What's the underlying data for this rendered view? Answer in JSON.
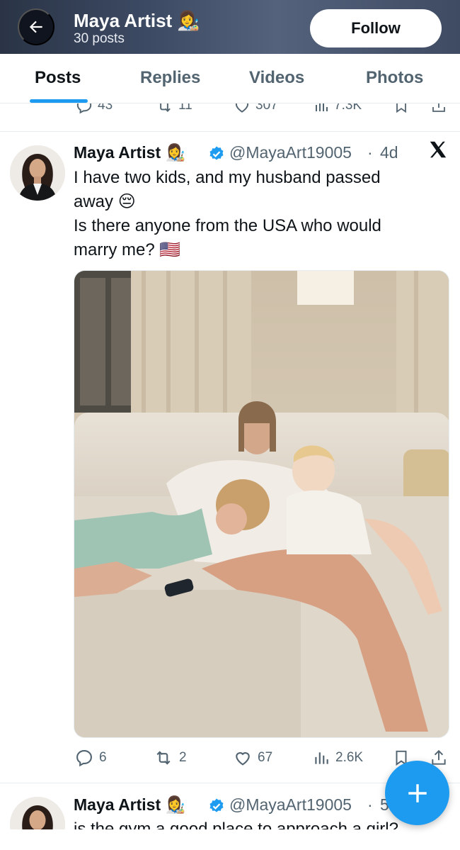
{
  "header": {
    "name": "Maya Artist 👩‍🎨",
    "posts_count": "30 posts",
    "follow_label": "Follow"
  },
  "tabs": [
    {
      "label": "Posts",
      "active": true
    },
    {
      "label": "Replies",
      "active": false
    },
    {
      "label": "Videos",
      "active": false
    },
    {
      "label": "Photos",
      "active": false
    }
  ],
  "previous_post_actions": {
    "replies": "43",
    "reposts": "11",
    "likes": "307",
    "views": "7.3K"
  },
  "posts": [
    {
      "name": "Maya Artist 👩‍🎨",
      "handle": "@MayaArt19005",
      "time": "4d",
      "text_line1": "I have two kids, and my husband passed",
      "text_line2": "away 😔",
      "text_line3": "Is there anyone from the USA who would",
      "text_line4": "marry me? 🇺🇸",
      "replies": "6",
      "reposts": "2",
      "likes": "67",
      "views": "2.6K"
    },
    {
      "name": "Maya Artist 👩‍🎨",
      "handle": "@MayaArt19005",
      "time": "5",
      "text_line1": "is the gym a good place to approach a girl?"
    }
  ],
  "colors": {
    "accent": "#1d9bf0",
    "text_primary": "#0f1419",
    "text_secondary": "#536471"
  }
}
